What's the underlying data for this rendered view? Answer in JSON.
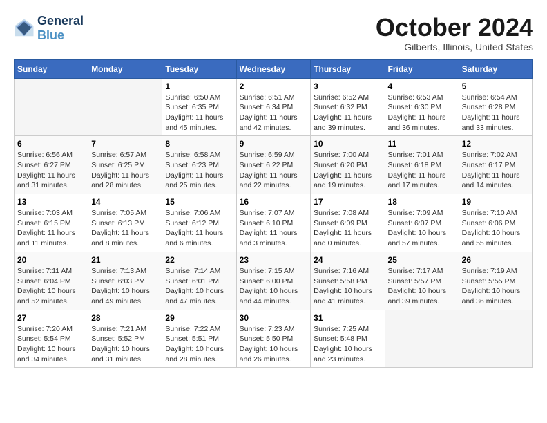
{
  "header": {
    "logo_line1": "General",
    "logo_line2": "Blue",
    "month": "October 2024",
    "location": "Gilberts, Illinois, United States"
  },
  "weekdays": [
    "Sunday",
    "Monday",
    "Tuesday",
    "Wednesday",
    "Thursday",
    "Friday",
    "Saturday"
  ],
  "weeks": [
    [
      {
        "day": "",
        "info": ""
      },
      {
        "day": "",
        "info": ""
      },
      {
        "day": "1",
        "info": "Sunrise: 6:50 AM\nSunset: 6:35 PM\nDaylight: 11 hours and 45 minutes."
      },
      {
        "day": "2",
        "info": "Sunrise: 6:51 AM\nSunset: 6:34 PM\nDaylight: 11 hours and 42 minutes."
      },
      {
        "day": "3",
        "info": "Sunrise: 6:52 AM\nSunset: 6:32 PM\nDaylight: 11 hours and 39 minutes."
      },
      {
        "day": "4",
        "info": "Sunrise: 6:53 AM\nSunset: 6:30 PM\nDaylight: 11 hours and 36 minutes."
      },
      {
        "day": "5",
        "info": "Sunrise: 6:54 AM\nSunset: 6:28 PM\nDaylight: 11 hours and 33 minutes."
      }
    ],
    [
      {
        "day": "6",
        "info": "Sunrise: 6:56 AM\nSunset: 6:27 PM\nDaylight: 11 hours and 31 minutes."
      },
      {
        "day": "7",
        "info": "Sunrise: 6:57 AM\nSunset: 6:25 PM\nDaylight: 11 hours and 28 minutes."
      },
      {
        "day": "8",
        "info": "Sunrise: 6:58 AM\nSunset: 6:23 PM\nDaylight: 11 hours and 25 minutes."
      },
      {
        "day": "9",
        "info": "Sunrise: 6:59 AM\nSunset: 6:22 PM\nDaylight: 11 hours and 22 minutes."
      },
      {
        "day": "10",
        "info": "Sunrise: 7:00 AM\nSunset: 6:20 PM\nDaylight: 11 hours and 19 minutes."
      },
      {
        "day": "11",
        "info": "Sunrise: 7:01 AM\nSunset: 6:18 PM\nDaylight: 11 hours and 17 minutes."
      },
      {
        "day": "12",
        "info": "Sunrise: 7:02 AM\nSunset: 6:17 PM\nDaylight: 11 hours and 14 minutes."
      }
    ],
    [
      {
        "day": "13",
        "info": "Sunrise: 7:03 AM\nSunset: 6:15 PM\nDaylight: 11 hours and 11 minutes."
      },
      {
        "day": "14",
        "info": "Sunrise: 7:05 AM\nSunset: 6:13 PM\nDaylight: 11 hours and 8 minutes."
      },
      {
        "day": "15",
        "info": "Sunrise: 7:06 AM\nSunset: 6:12 PM\nDaylight: 11 hours and 6 minutes."
      },
      {
        "day": "16",
        "info": "Sunrise: 7:07 AM\nSunset: 6:10 PM\nDaylight: 11 hours and 3 minutes."
      },
      {
        "day": "17",
        "info": "Sunrise: 7:08 AM\nSunset: 6:09 PM\nDaylight: 11 hours and 0 minutes."
      },
      {
        "day": "18",
        "info": "Sunrise: 7:09 AM\nSunset: 6:07 PM\nDaylight: 10 hours and 57 minutes."
      },
      {
        "day": "19",
        "info": "Sunrise: 7:10 AM\nSunset: 6:06 PM\nDaylight: 10 hours and 55 minutes."
      }
    ],
    [
      {
        "day": "20",
        "info": "Sunrise: 7:11 AM\nSunset: 6:04 PM\nDaylight: 10 hours and 52 minutes."
      },
      {
        "day": "21",
        "info": "Sunrise: 7:13 AM\nSunset: 6:03 PM\nDaylight: 10 hours and 49 minutes."
      },
      {
        "day": "22",
        "info": "Sunrise: 7:14 AM\nSunset: 6:01 PM\nDaylight: 10 hours and 47 minutes."
      },
      {
        "day": "23",
        "info": "Sunrise: 7:15 AM\nSunset: 6:00 PM\nDaylight: 10 hours and 44 minutes."
      },
      {
        "day": "24",
        "info": "Sunrise: 7:16 AM\nSunset: 5:58 PM\nDaylight: 10 hours and 41 minutes."
      },
      {
        "day": "25",
        "info": "Sunrise: 7:17 AM\nSunset: 5:57 PM\nDaylight: 10 hours and 39 minutes."
      },
      {
        "day": "26",
        "info": "Sunrise: 7:19 AM\nSunset: 5:55 PM\nDaylight: 10 hours and 36 minutes."
      }
    ],
    [
      {
        "day": "27",
        "info": "Sunrise: 7:20 AM\nSunset: 5:54 PM\nDaylight: 10 hours and 34 minutes."
      },
      {
        "day": "28",
        "info": "Sunrise: 7:21 AM\nSunset: 5:52 PM\nDaylight: 10 hours and 31 minutes."
      },
      {
        "day": "29",
        "info": "Sunrise: 7:22 AM\nSunset: 5:51 PM\nDaylight: 10 hours and 28 minutes."
      },
      {
        "day": "30",
        "info": "Sunrise: 7:23 AM\nSunset: 5:50 PM\nDaylight: 10 hours and 26 minutes."
      },
      {
        "day": "31",
        "info": "Sunrise: 7:25 AM\nSunset: 5:48 PM\nDaylight: 10 hours and 23 minutes."
      },
      {
        "day": "",
        "info": ""
      },
      {
        "day": "",
        "info": ""
      }
    ]
  ]
}
